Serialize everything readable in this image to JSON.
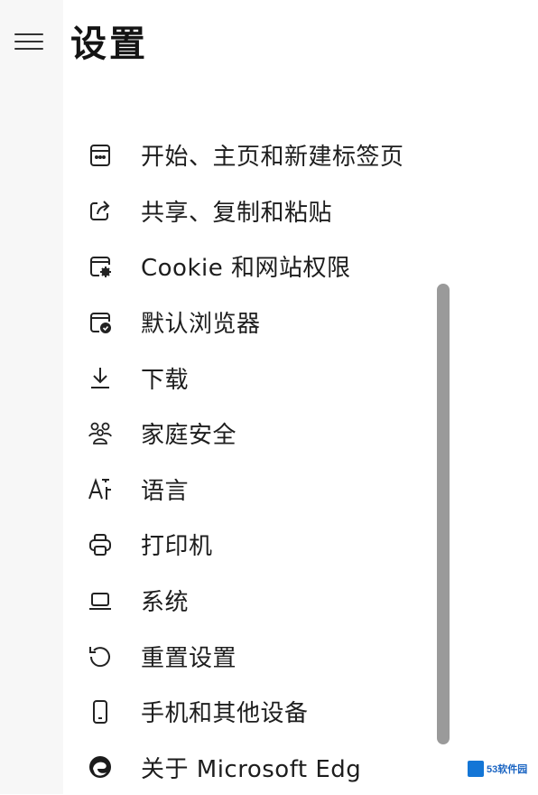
{
  "header": {
    "title": "设置",
    "menu_icon": "hamburger-menu-icon"
  },
  "nav": {
    "items": [
      {
        "label": "开始、主页和新建标签页",
        "icon": "new-tab-page-icon"
      },
      {
        "label": "共享、复制和粘贴",
        "icon": "share-icon"
      },
      {
        "label": "Cookie 和网站权限",
        "icon": "site-permissions-icon"
      },
      {
        "label": "默认浏览器",
        "icon": "default-browser-icon"
      },
      {
        "label": "下载",
        "icon": "download-icon"
      },
      {
        "label": "家庭安全",
        "icon": "family-icon"
      },
      {
        "label": "语言",
        "icon": "language-icon"
      },
      {
        "label": "打印机",
        "icon": "printer-icon"
      },
      {
        "label": "系统",
        "icon": "laptop-icon"
      },
      {
        "label": "重置设置",
        "icon": "reset-icon"
      },
      {
        "label": "手机和其他设备",
        "icon": "phone-icon"
      },
      {
        "label": "关于 Microsoft Edg",
        "icon": "edge-logo-icon"
      }
    ]
  },
  "watermark": {
    "text": "53软件园"
  }
}
